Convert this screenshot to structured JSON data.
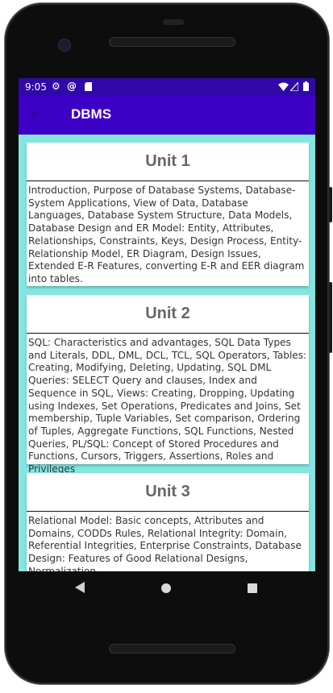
{
  "status_bar": {
    "time": "9:05",
    "left_icons": [
      "gear-icon",
      "at-sign-icon",
      "sd-card-icon"
    ],
    "right_icons": [
      "wifi-icon",
      "signal-icon",
      "battery-icon"
    ]
  },
  "app_bar": {
    "back_icon": "arrow-back-icon",
    "title": "DBMS"
  },
  "units": [
    {
      "title": "Unit 1",
      "body": "Introduction, Purpose of Database Systems, Database-System Applications, View of Data, Database Languages, Database System Structure, Data Models, Database Design and ER Model: Entity, Attributes, Relationships, Constraints, Keys, Design Process, Entity-Relationship Model, ER Diagram, Design Issues, Extended E-R Features, converting E-R and EER diagram into tables."
    },
    {
      "title": "Unit 2",
      "body": "SQL: Characteristics and advantages, SQL Data Types and Literals, DDL, DML, DCL, TCL, SQL Operators, Tables: Creating, Modifying, Deleting, Updating, SQL DML Queries: SELECT Query and clauses, Index and Sequence in SQL, Views: Creating, Dropping, Updating using Indexes, Set Operations, Predicates and Joins, Set membership, Tuple Variables, Set comparison, Ordering of Tuples, Aggregate Functions, SQL Functions, Nested Queries, PL/SQL: Concept of Stored Procedures and Functions, Cursors, Triggers, Assertions, Roles and Privileges"
    },
    {
      "title": "Unit 3",
      "body": "Relational Model: Basic concepts, Attributes and Domains, CODDs Rules, Relational Integrity: Domain, Referential Integrities, Enterprise Constraints, Database Design: Features of Good Relational Designs, Normalization,"
    }
  ],
  "nav_bar": {
    "icons": [
      "nav-back-icon",
      "nav-home-icon",
      "nav-recents-icon"
    ]
  },
  "colors": {
    "status_bar": "#3009a8",
    "app_bar": "#3c00c7",
    "content_background": "#85e6e1",
    "card_background": "#ffffff",
    "card_title_text": "#666666"
  }
}
